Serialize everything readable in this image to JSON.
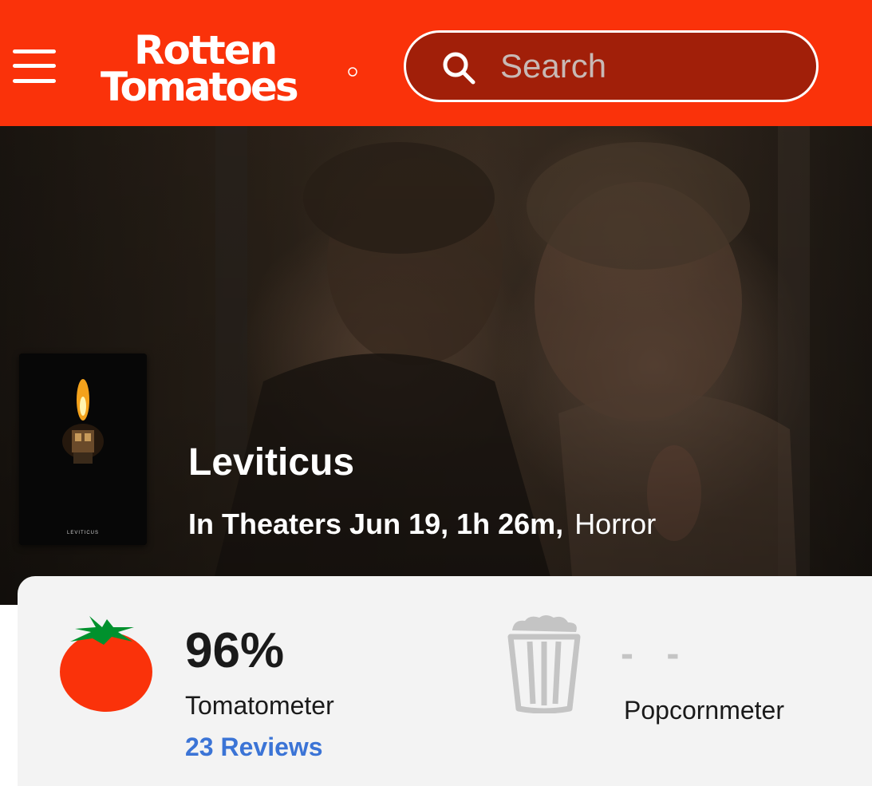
{
  "header": {
    "logo_line1": "Rotten",
    "logo_line2": "Tomatoes",
    "search_placeholder": "Search",
    "brand_color": "#fa320a"
  },
  "movie": {
    "title": "Leviticus",
    "release_info": "In Theaters Jun 19, 1h 26m,",
    "genre": "Horror",
    "poster_text": "LEVITICUS"
  },
  "scores": {
    "tomatometer": {
      "value": "96%",
      "label": "Tomatometer",
      "reviews": "23 Reviews",
      "icon": "fresh-tomato-icon"
    },
    "popcornmeter": {
      "value": "- -",
      "label": "Popcornmeter",
      "icon": "empty-popcorn-bucket-icon"
    }
  }
}
